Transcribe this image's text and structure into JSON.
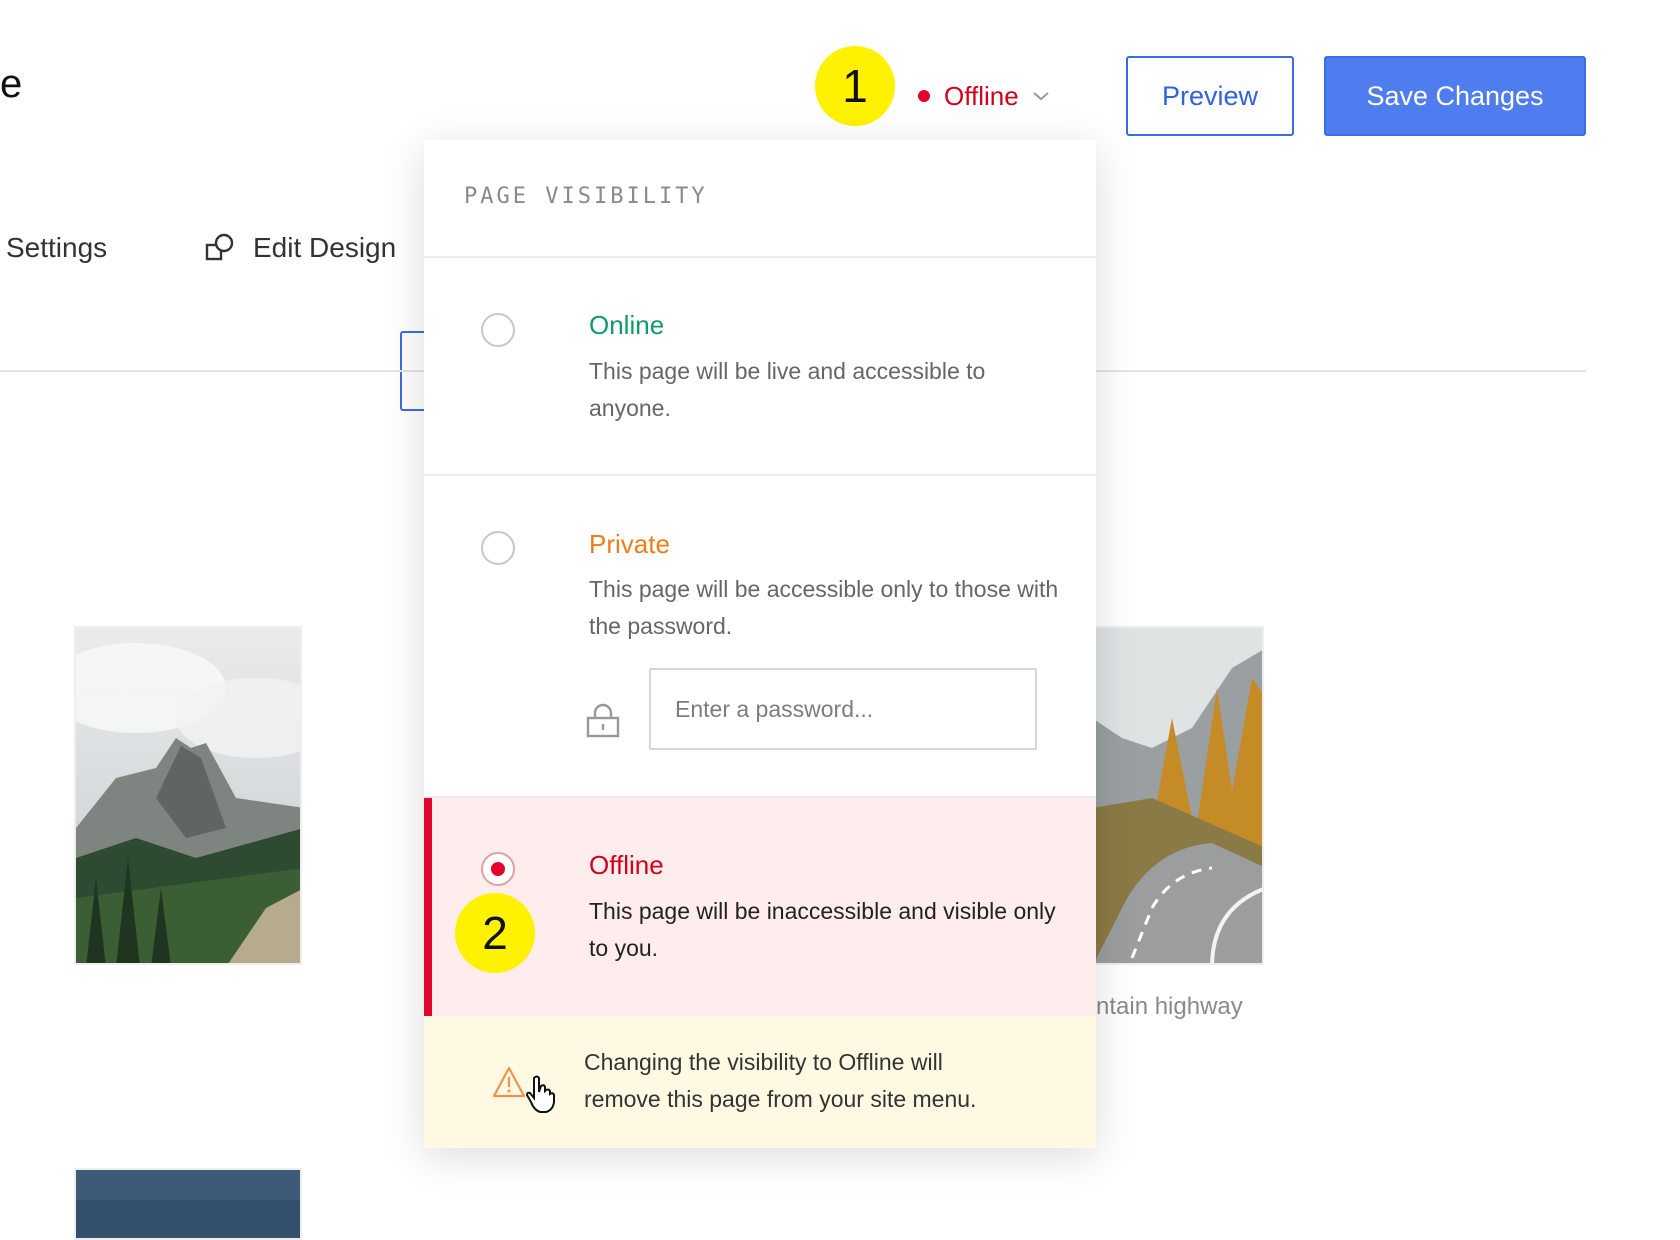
{
  "header": {
    "title_fragment": "e",
    "badge_1": "1",
    "status": {
      "label": "Offline",
      "color": "#e4032e"
    },
    "preview_label": "Preview",
    "save_label": "Save Changes"
  },
  "nav": {
    "settings_label": "Settings",
    "edit_design_label": "Edit Design"
  },
  "gallery": {
    "caption_fragment": "ntain highway"
  },
  "popover": {
    "heading": "PAGE VISIBILITY",
    "options": [
      {
        "title": "Online",
        "description": "This page will be live and accessible to anyone.",
        "color": "#119a6c",
        "selected": false
      },
      {
        "title": "Private",
        "description": "This page will be accessible only to those with the password.",
        "color": "#f07c1c",
        "selected": false
      },
      {
        "title": "Offline",
        "description": "This page will be inaccessible and visible only to you.",
        "color": "#d0021b",
        "selected": true
      }
    ],
    "password_placeholder": "Enter a password...",
    "badge_2": "2",
    "warning_text": "Changing the visibility to Offline will remove this page from your site menu."
  },
  "colors": {
    "accent_blue": "#4f7df0",
    "highlight_yellow": "#fff200",
    "offline_bg": "#ffecec",
    "warning_bg": "#fff9e3"
  },
  "icons": [
    "chevron-down-icon",
    "edit-design-icon",
    "lock-icon",
    "warning-icon",
    "hand-cursor-icon"
  ]
}
